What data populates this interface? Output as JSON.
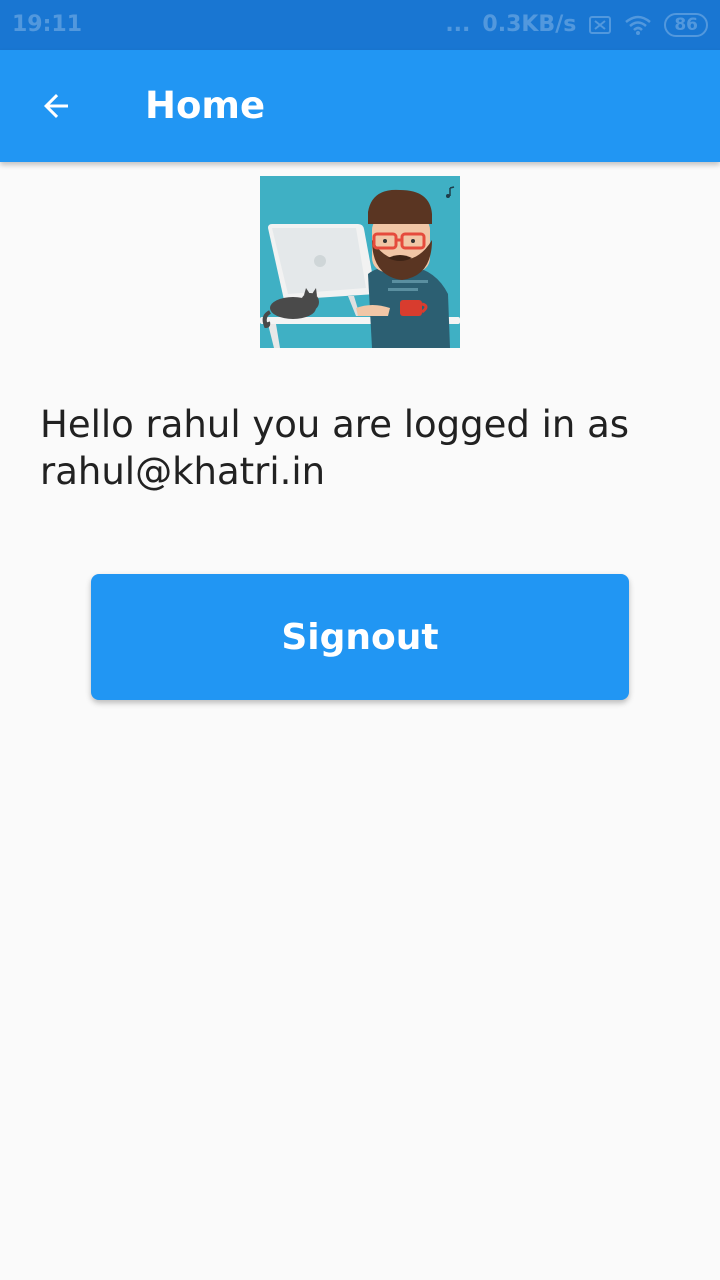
{
  "status_bar": {
    "time": "19:11",
    "dots": "...",
    "network_speed": "0.3KB/s",
    "battery": "86",
    "icons": [
      "sim-off-icon",
      "wifi-icon",
      "battery-icon"
    ]
  },
  "app_bar": {
    "title": "Home",
    "back_icon": "arrow-back-icon"
  },
  "profile": {
    "image": "developer-avatar"
  },
  "greeting": "Hello rahul you are logged in as rahul@khatri.in",
  "signout_label": "Signout",
  "colors": {
    "primary": "#2196f3",
    "primary_dark": "#1976d2",
    "background": "#fafafa",
    "text": "#212121"
  }
}
